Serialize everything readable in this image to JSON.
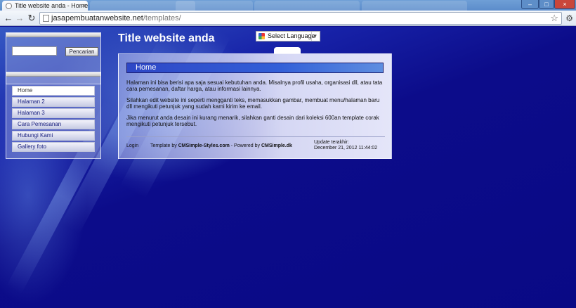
{
  "browser": {
    "tab_title": "Title website anda - Home",
    "tab_close": "×",
    "url_host": "jasapembuatanwebsite.net",
    "url_path": "/templates/",
    "back": "←",
    "forward": "→",
    "reload": "↻",
    "star": "☆",
    "wrench": "🔧",
    "minimize": "–",
    "maximize": "□",
    "close": "×"
  },
  "site": {
    "title": "Title website anda"
  },
  "search": {
    "value": "",
    "button_label": "Pencarian"
  },
  "menu": {
    "items": [
      {
        "label": "Home"
      },
      {
        "label": "Halaman 2"
      },
      {
        "label": "Halaman 3"
      },
      {
        "label": "Cara Pemesanan"
      },
      {
        "label": "Hubungi Kami"
      },
      {
        "label": "Gallery foto"
      }
    ]
  },
  "translate": {
    "label": "Select Language",
    "caret": "▼"
  },
  "content": {
    "heading": "Home",
    "paragraphs": [
      "Halaman ini bisa berisi apa saja sesuai kebutuhan anda. Misalnya profil usaha, organisasi dll, atau tata cara pemesanan, daftar harga, atau informasi lainnya.",
      "Silahkan edit website ini seperti mengganti teks, memasukkan gambar, membuat menu/halaman baru dll mengikuti petunjuk yang sudah kami kirim ke email.",
      "Jika menurut anda desain ini kurang menarik, silahkan ganti desain dari koleksi 600an template corak mengikuti petunjuk tersebut."
    ]
  },
  "footer": {
    "login": "Login",
    "template_by": "Template by ",
    "template_site": "CMSimple-Styles.com",
    "powered_by": " - Powered by ",
    "powered_site": "CMSimple.dk",
    "update_label": "Update terakhir:",
    "update_date": "December 21, 2012 11:44:02"
  }
}
